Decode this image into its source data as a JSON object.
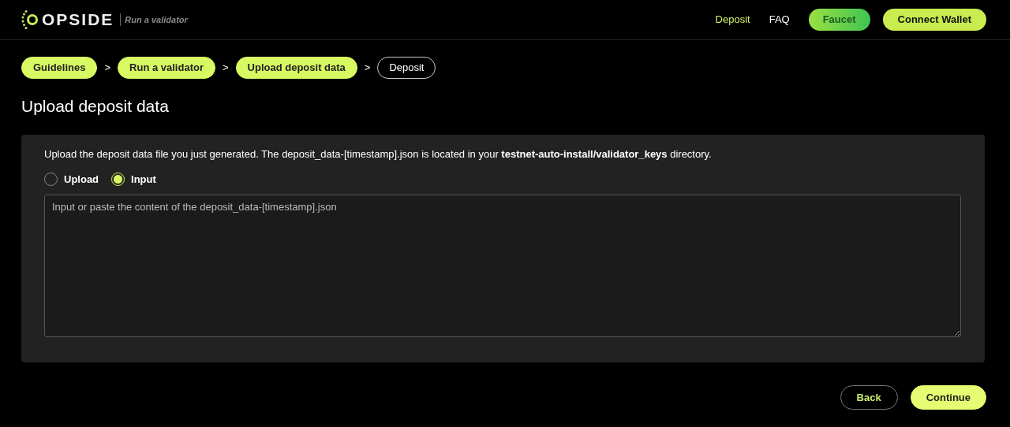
{
  "header": {
    "logo_text": "OPSIDE",
    "tagline": "Run a validator",
    "nav": [
      {
        "label": "Deposit",
        "selected": true
      },
      {
        "label": "FAQ",
        "selected": false
      }
    ],
    "buttons": [
      {
        "label": "Faucet",
        "kind": "faucet"
      },
      {
        "label": "Connect Wallet",
        "kind": "wallet"
      }
    ]
  },
  "steps": [
    {
      "label": "Guidelines",
      "done": true
    },
    {
      "label": "Run a validator",
      "done": true
    },
    {
      "label": "Upload deposit data",
      "done": true
    },
    {
      "label": "Deposit",
      "done": false
    }
  ],
  "step_separator": ">",
  "title": "Upload deposit data",
  "panel": {
    "description": "Upload the deposit data file you just generated. The deposit_data-[timestamp].json is located in your **testnet-auto-install/validator_keys** directory.",
    "options": [
      {
        "label": "Upload",
        "selected": false
      },
      {
        "label": "Input",
        "selected": true
      }
    ],
    "textarea": {
      "placeholder": "Input or paste the content of the deposit_data-[timestamp].json"
    }
  },
  "footer_buttons": [
    {
      "label": "Back",
      "kind": "outline"
    },
    {
      "label": "Continue",
      "kind": "primary"
    }
  ]
}
